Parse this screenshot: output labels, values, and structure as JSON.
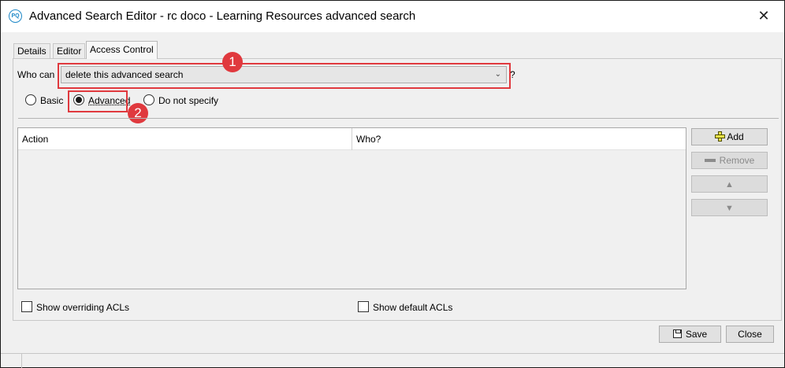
{
  "window": {
    "title": "Advanced Search Editor - rc doco - Learning Resources advanced search",
    "app_icon_text": "PQ",
    "close_glyph": "✕"
  },
  "tabs": [
    {
      "label": "Details"
    },
    {
      "label": "Editor"
    },
    {
      "label": "Access Control"
    }
  ],
  "access_control": {
    "who_can_label": "Who can",
    "permission_selected": "delete this advanced search",
    "question_mark": "?",
    "mode_options": {
      "basic": "Basic",
      "advanced": "Advanced",
      "none": "Do not specify"
    },
    "selected_mode": "Advanced",
    "table": {
      "columns": [
        "Action",
        "Who?"
      ],
      "rows": []
    },
    "buttons": {
      "add": "Add",
      "remove": "Remove"
    },
    "show_overriding_acls": "Show overriding ACLs",
    "show_default_acls": "Show default ACLs"
  },
  "annotations": [
    {
      "number": "1"
    },
    {
      "number": "2"
    }
  ],
  "footer": {
    "save": "Save",
    "close": "Close"
  },
  "colors": {
    "annotation_red": "#e0393e",
    "brand_blue": "#1e88c7"
  }
}
